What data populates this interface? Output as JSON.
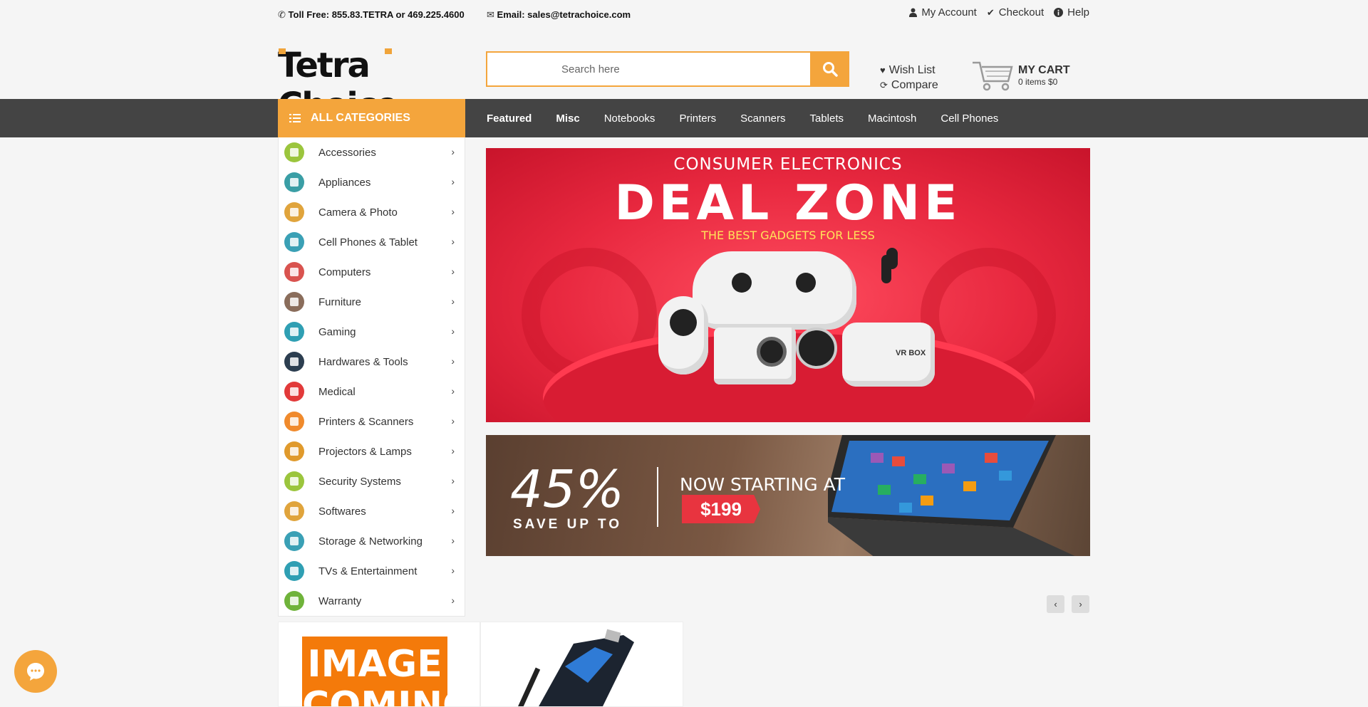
{
  "topbar": {
    "phone_label": "Toll Free:",
    "phone_value": "855.83.TETRA or 469.225.4600",
    "email_label": "Email:",
    "email_value": "sales@tetrachoice.com",
    "links": [
      "My Account",
      "Checkout",
      "Help"
    ]
  },
  "header": {
    "logo_text": "Tetra Choice",
    "search_placeholder": "Search here",
    "wishlist": "Wish List",
    "compare": "Compare",
    "cart_title": "MY CART",
    "cart_summary": "0 items $0"
  },
  "nav": {
    "all_categories": "ALL CATEGORIES",
    "links": [
      "Featured",
      "Misc",
      "Notebooks",
      "Printers",
      "Scanners",
      "Tablets",
      "Macintosh",
      "Cell Phones"
    ]
  },
  "categories": [
    {
      "label": "Accessories",
      "color": "#9bc53d"
    },
    {
      "label": "Appliances",
      "color": "#3a9ea5"
    },
    {
      "label": "Camera & Photo",
      "color": "#e0a43c"
    },
    {
      "label": "Cell Phones & Tablet",
      "color": "#3aa0b5"
    },
    {
      "label": "Computers",
      "color": "#d9534f"
    },
    {
      "label": "Furniture",
      "color": "#8a6d5b"
    },
    {
      "label": "Gaming",
      "color": "#2f9fb3"
    },
    {
      "label": "Hardwares & Tools",
      "color": "#2c3e50"
    },
    {
      "label": "Medical",
      "color": "#e23a3a"
    },
    {
      "label": "Printers & Scanners",
      "color": "#f08a2c"
    },
    {
      "label": "Projectors & Lamps",
      "color": "#e09a2c"
    },
    {
      "label": "Security Systems",
      "color": "#9bc53d"
    },
    {
      "label": "Softwares",
      "color": "#e0a43c"
    },
    {
      "label": "Storage & Networking",
      "color": "#3aa0b5"
    },
    {
      "label": "TVs & Entertainment",
      "color": "#2f9fb3"
    },
    {
      "label": "Warranty",
      "color": "#6fb33a"
    }
  ],
  "banner1": {
    "line1": "CONSUMER ELECTRONICS",
    "line2": "DEAL ZONE",
    "line3": "THE BEST GADGETS FOR LESS",
    "vr_label": "VR BOX"
  },
  "banner2": {
    "percent": "45%",
    "save": "SAVE UP TO",
    "now": "NOW STARTING AT",
    "price": "$199"
  },
  "products": {
    "placeholder_text": "IMAGE COMING"
  },
  "colors": {
    "accent": "#f4a53c",
    "nav_bg": "#444444"
  }
}
